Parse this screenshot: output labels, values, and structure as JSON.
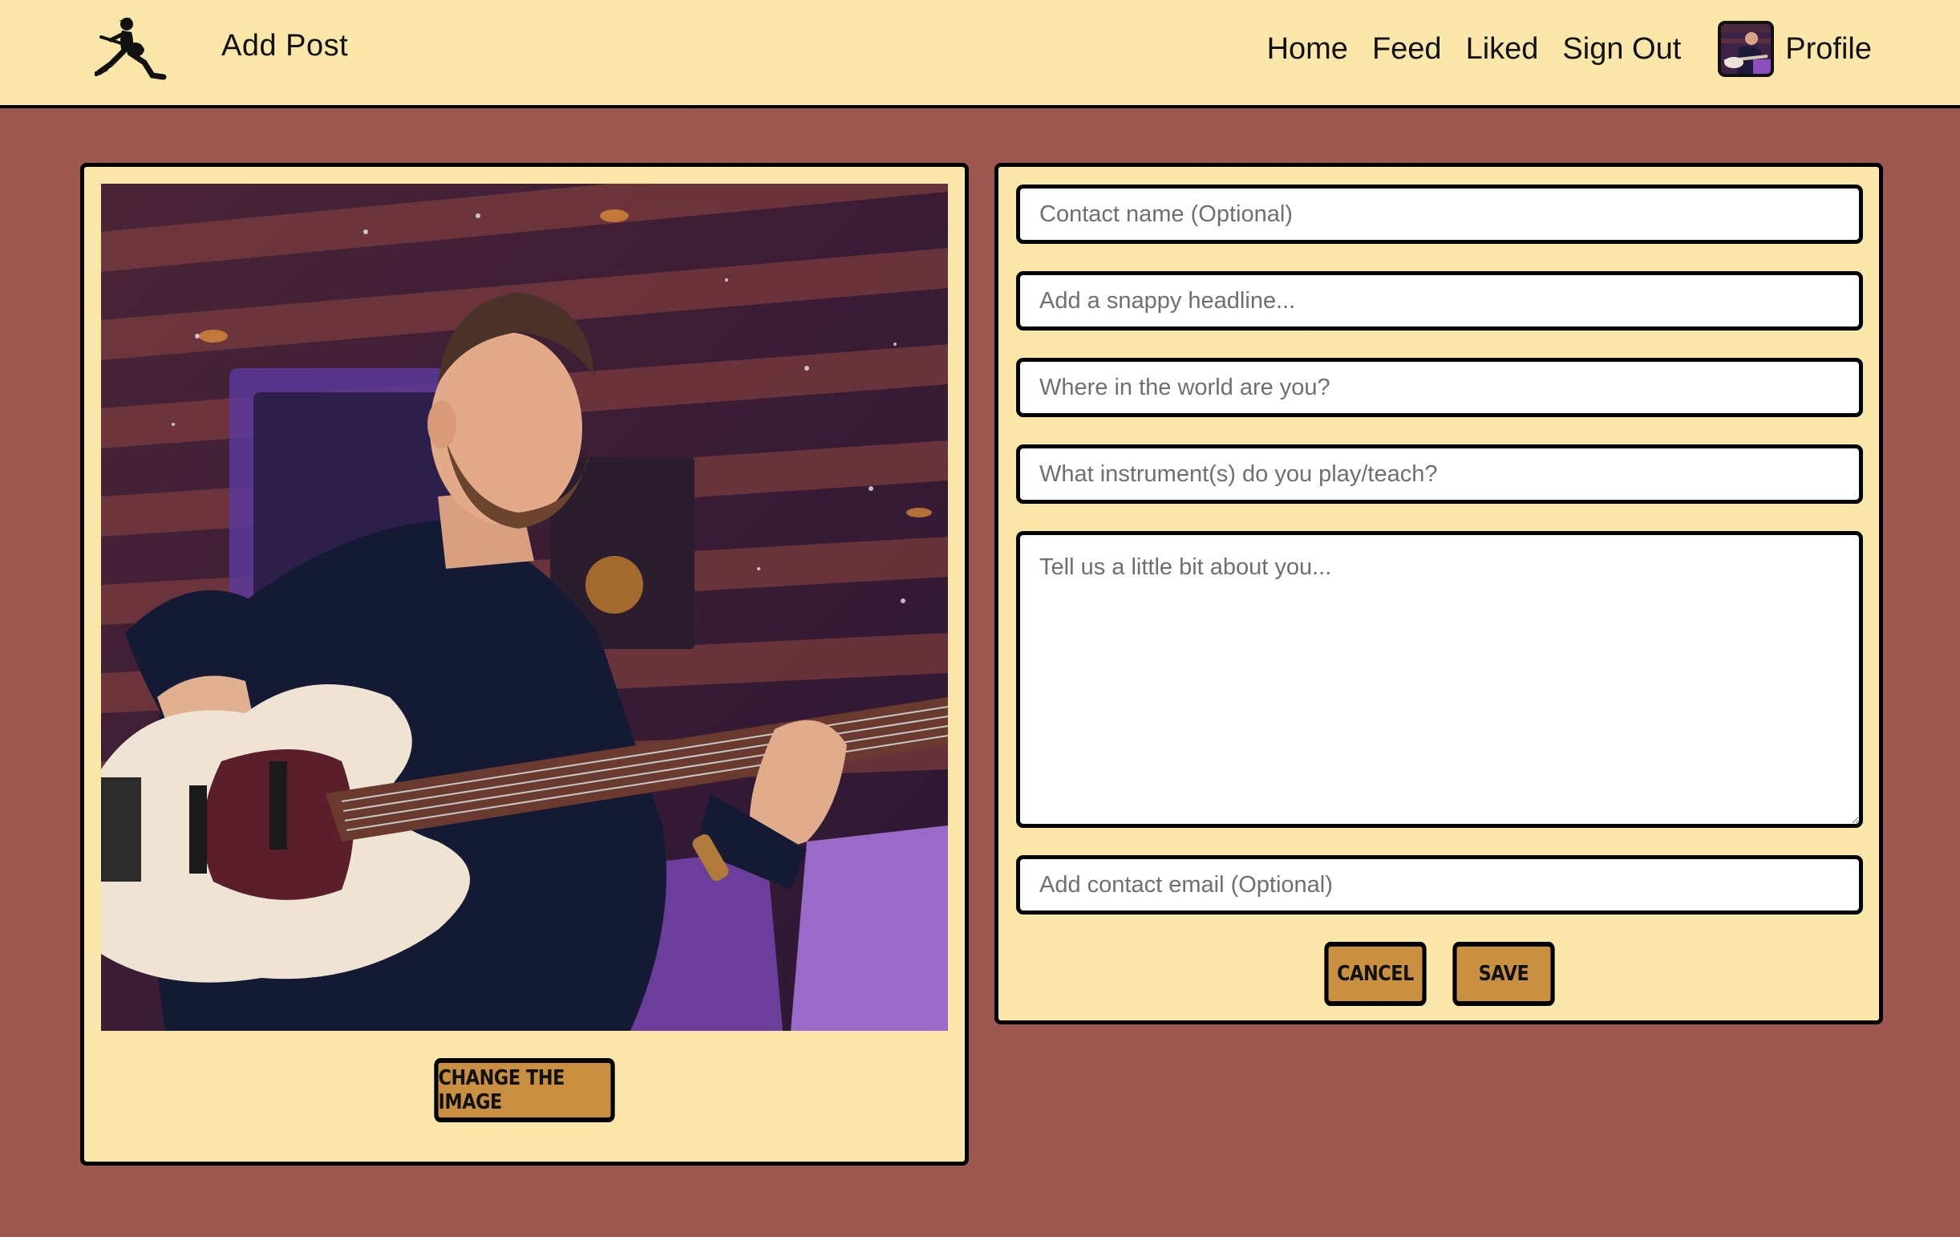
{
  "header": {
    "title": "Add Post",
    "nav": {
      "home": "Home",
      "feed": "Feed",
      "liked": "Liked",
      "sign_out": "Sign Out",
      "profile": "Profile"
    }
  },
  "post_image": {
    "change_button": "CHANGE THE IMAGE"
  },
  "form": {
    "contact_name": {
      "placeholder": "Contact name (Optional)",
      "value": ""
    },
    "headline": {
      "placeholder": "Add a snappy headline...",
      "value": ""
    },
    "location": {
      "placeholder": "Where in the world are you?",
      "value": ""
    },
    "instruments": {
      "placeholder": "What instrument(s) do you play/teach?",
      "value": ""
    },
    "about": {
      "placeholder": "Tell us a little bit about you...",
      "value": ""
    },
    "contact_email": {
      "placeholder": "Add contact email (Optional)",
      "value": ""
    },
    "cancel_label": "CANCEL",
    "save_label": "SAVE"
  },
  "theme": {
    "background": "#9f5751",
    "panel": "#fce7aa",
    "button": "#c99042",
    "border": "#000000"
  },
  "icons": {
    "logo": "guitarist-logo-icon",
    "avatar": "user-avatar"
  }
}
